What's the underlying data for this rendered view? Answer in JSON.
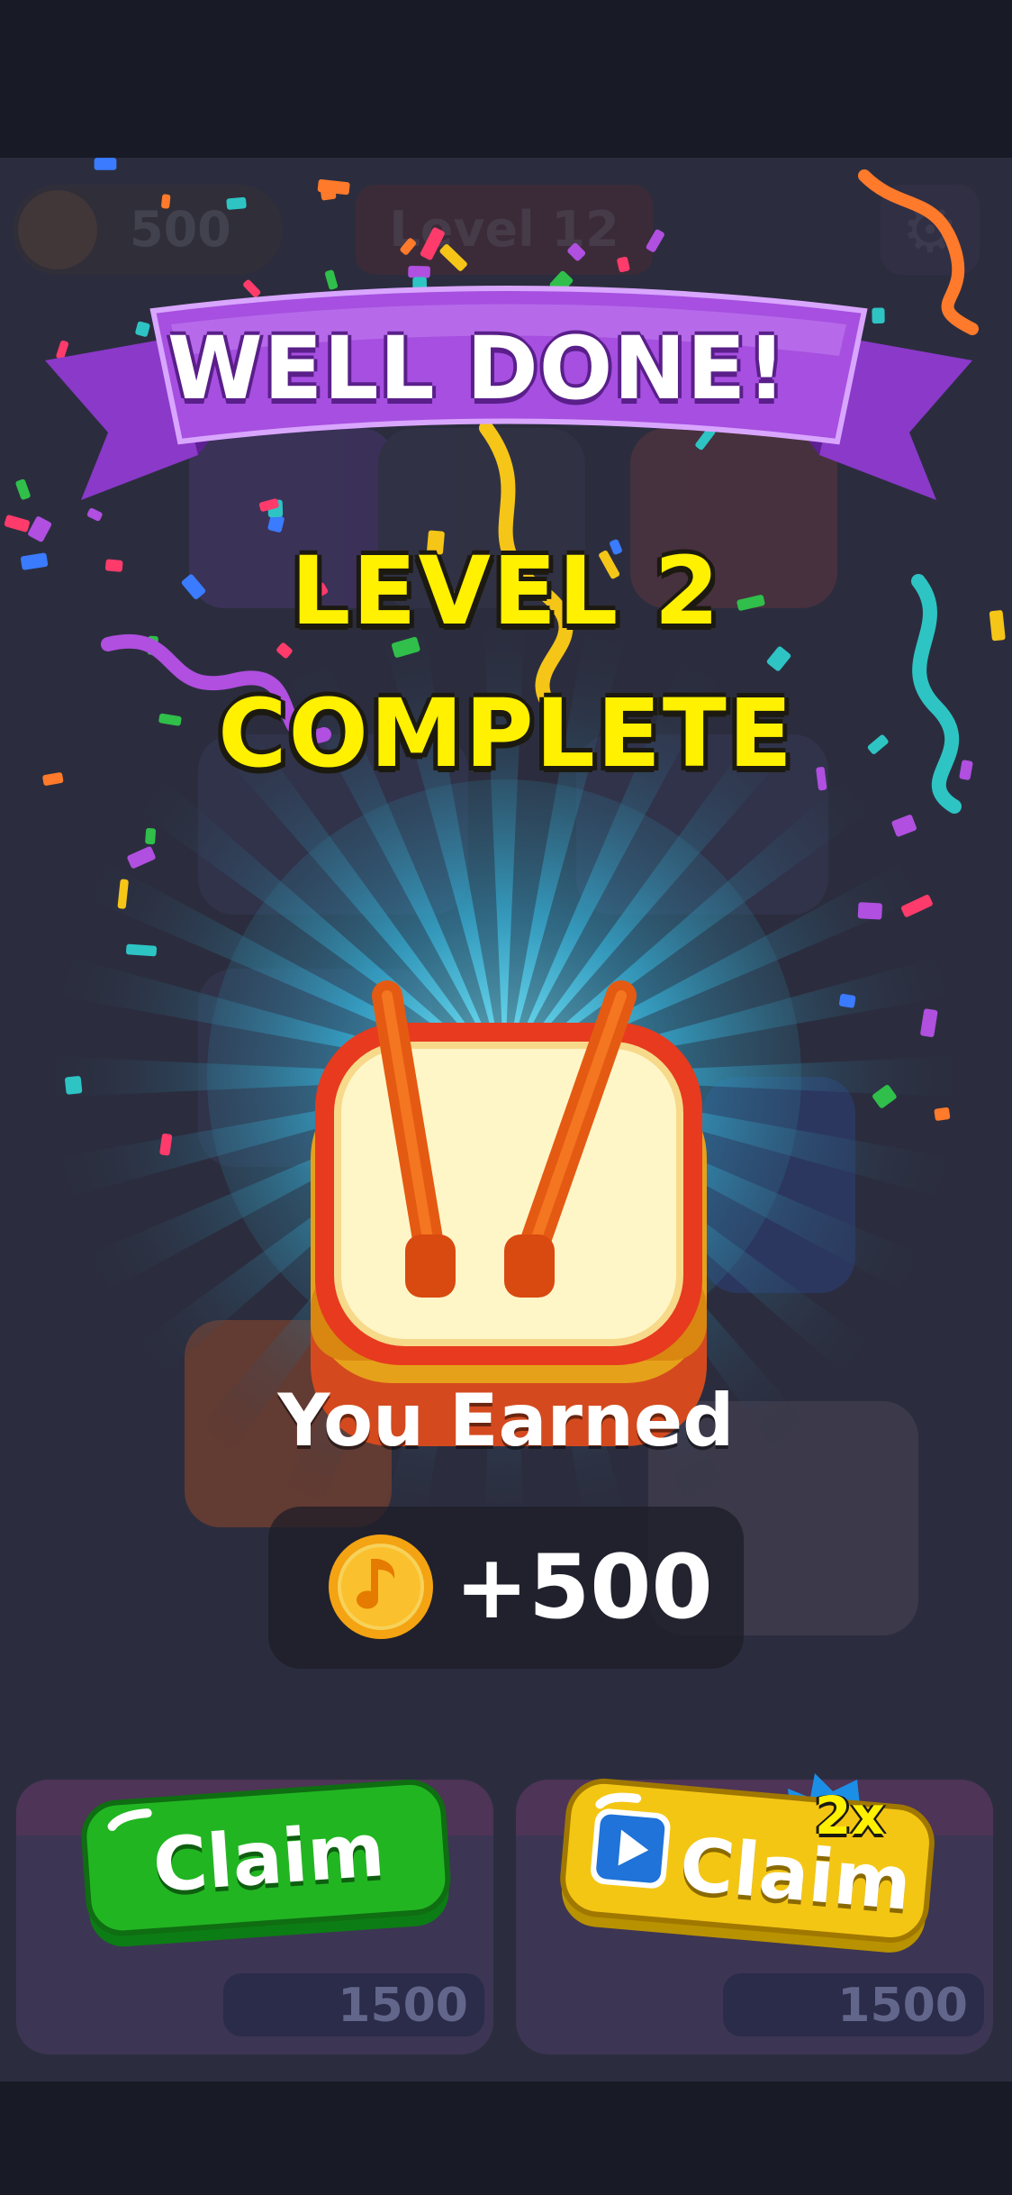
{
  "hud": {
    "coins": "500",
    "level": "Level 12"
  },
  "popup": {
    "banner": "WELL DONE!",
    "title_line1": "LEVEL 2",
    "title_line2": "COMPLETE",
    "earned_label": "You Earned",
    "reward_amount": "+500",
    "reward_icon": "music-coin-icon",
    "item_icon": "drum-icon"
  },
  "buttons": {
    "claim_label": "Claim",
    "claim_ad_label": "Claim",
    "multiplier": "2x",
    "claim_ad_icon": "play-video-icon"
  },
  "background_cards": [
    {
      "price": "1500"
    },
    {
      "price": "1500"
    }
  ],
  "colors": {
    "banner": "#a64fe0",
    "title": "#fff100",
    "claim_green": "#1fb21f",
    "claim_yellow": "#f1c40f",
    "glow": "#39c6e8"
  }
}
